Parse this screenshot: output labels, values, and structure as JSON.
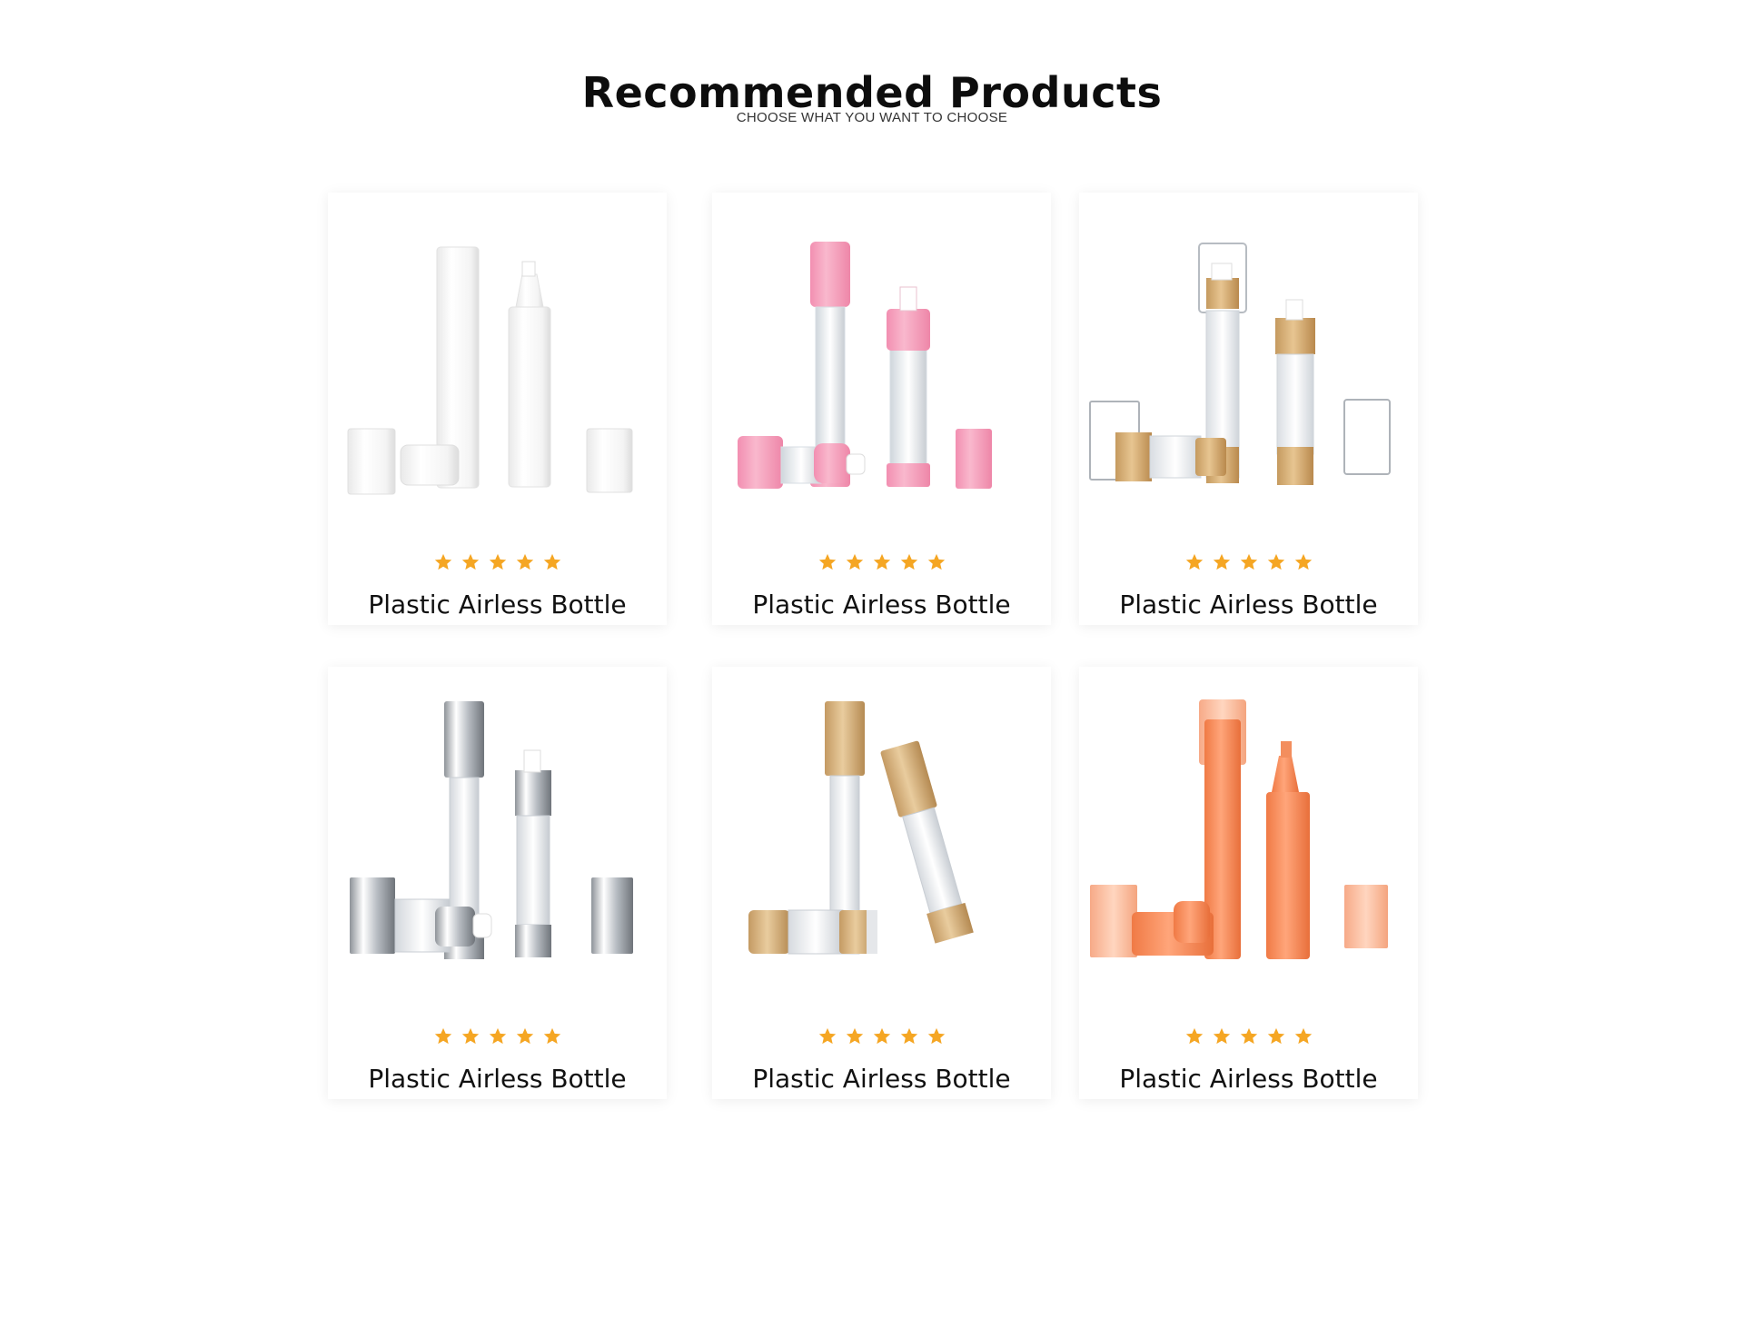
{
  "section": {
    "title": "Recommended Products",
    "subtitle": "CHOOSE WHAT YOU WANT TO CHOOSE"
  },
  "products": [
    {
      "title": "Plastic Airless Bottle",
      "rating": 5,
      "variant": "white"
    },
    {
      "title": "Plastic Airless Bottle",
      "rating": 5,
      "variant": "pink"
    },
    {
      "title": "Plastic Airless Bottle",
      "rating": 5,
      "variant": "bamboo-clear"
    },
    {
      "title": "Plastic Airless Bottle",
      "rating": 5,
      "variant": "silver"
    },
    {
      "title": "Plastic Airless Bottle",
      "rating": 5,
      "variant": "bamboo"
    },
    {
      "title": "Plastic Airless Bottle",
      "rating": 5,
      "variant": "orange"
    }
  ],
  "colors": {
    "star": "#F5A623",
    "heading": "#0d0d0d"
  }
}
